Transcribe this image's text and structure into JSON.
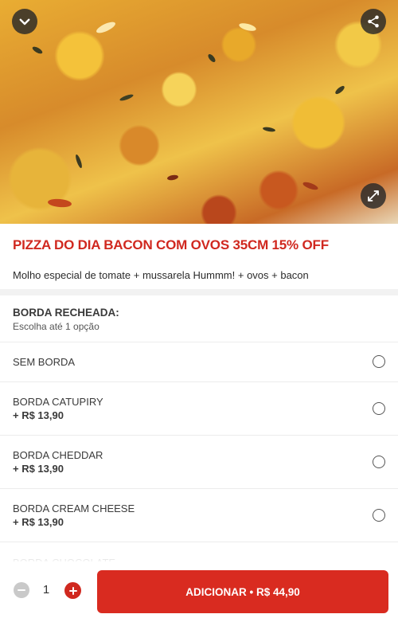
{
  "product": {
    "title": "PIZZA DO DIA BACON COM OVOS 35CM 15% OFF",
    "description": "Molho especial de tomate + mussarela Hummm! + ovos + bacon"
  },
  "hero": {
    "icons": [
      "chevron-down-icon",
      "share-icon",
      "expand-icon"
    ]
  },
  "group": {
    "title": "BORDA RECHEADA:",
    "subtitle": "Escolha até 1 opção",
    "options": [
      {
        "name": "SEM BORDA",
        "price": "",
        "selected": false
      },
      {
        "name": "BORDA CATUPIRY",
        "price": "+ R$ 13,90",
        "selected": false
      },
      {
        "name": "BORDA CHEDDAR",
        "price": "+ R$ 13,90",
        "selected": false
      },
      {
        "name": "BORDA CREAM CHEESE",
        "price": "+ R$ 13,90",
        "selected": false
      },
      {
        "name": "BORDA CHOCOLATE",
        "price": "",
        "selected": false
      }
    ]
  },
  "footer": {
    "quantity": "1",
    "add_label": "ADICIONAR • R$ 44,90"
  },
  "colors": {
    "accent": "#d0281f",
    "button": "#d92b20"
  }
}
